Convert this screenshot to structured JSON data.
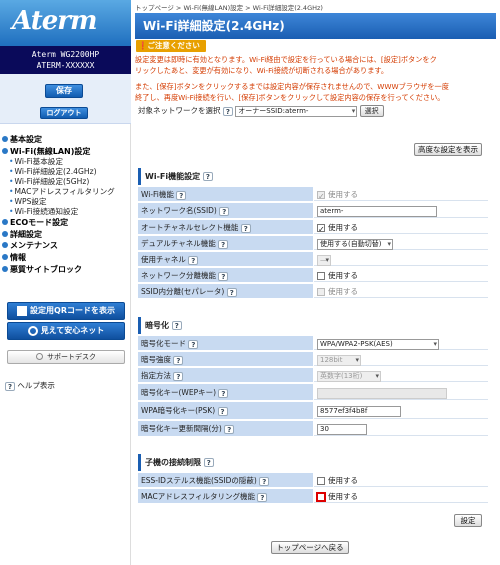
{
  "logo": "Aterm",
  "model": {
    "line1": "Aterm WG2200HP",
    "line2": "ATERM-XXXXXX"
  },
  "side_buttons": {
    "save": "保存",
    "logout": "ログアウト"
  },
  "nav": [
    {
      "label": "基本設定",
      "level": 1
    },
    {
      "label": "Wi-Fi(無線LAN)設定",
      "level": 1
    },
    {
      "label": "Wi-Fi基本設定",
      "level": 2
    },
    {
      "label": "Wi-Fi詳細設定(2.4GHz)",
      "level": 2
    },
    {
      "label": "Wi-Fi詳細設定(5GHz)",
      "level": 2
    },
    {
      "label": "MACアドレスフィルタリング",
      "level": 2
    },
    {
      "label": "WPS設定",
      "level": 2
    },
    {
      "label": "Wi-Fi接続通知設定",
      "level": 2
    },
    {
      "label": "ECOモード設定",
      "level": 1
    },
    {
      "label": "詳細設定",
      "level": 1
    },
    {
      "label": "メンテナンス",
      "level": 1
    },
    {
      "label": "情報",
      "level": 1
    },
    {
      "label": "悪質サイトブロック",
      "level": 1
    }
  ],
  "side_boxes": {
    "qr": "設定用QRコードを表示",
    "anshin": "見えて安心ネット",
    "support": "サポートデスク",
    "help": "ヘルプ表示"
  },
  "breadcrumb": "トップページ > Wi-Fi(無線LAN)設定 > Wi-Fi詳細設定(2.4GHz)",
  "page_title": "Wi-Fi詳細設定(2.4GHz)",
  "caution_label": "ご注意ください",
  "warn1a": "設定変更は即時に有効となります。Wi-Fi経由で設定を行っている場合には、[設定]ボタンをク",
  "warn1b": "リックしたあと、変更が有効になり、Wi-Fi接続が切断される場合があります。",
  "warn2a": "また、[保存]ボタンをクリックするまでは設定内容が保存されませんので、WWWブラウザを一度",
  "warn2b": "終了し、再度Wi-Fi接続を行い、[保存]ボタンをクリックして設定内容の保存を行ってください。",
  "target": {
    "label": "対象ネットワークを選択",
    "value": "オーナーSSID:aterm-",
    "select_btn": "選択"
  },
  "advanced_btn": "高度な設定を表示",
  "sec1": {
    "title": "Wi-Fi機能設定",
    "rows": [
      {
        "label": "Wi-Fi機能",
        "value": "使用する"
      },
      {
        "label": "ネットワーク名(SSID)",
        "value": "aterm-"
      },
      {
        "label": "オートチャネルセレクト機能",
        "value": "使用する"
      },
      {
        "label": "デュアルチャネル機能",
        "value": "使用する(自動切替)"
      },
      {
        "label": "使用チャネル",
        "value": "—"
      },
      {
        "label": "ネットワーク分離機能",
        "value": "使用する"
      },
      {
        "label": "SSID内分離(セパレータ)",
        "value": "使用する"
      }
    ]
  },
  "sec2": {
    "title": "暗号化",
    "rows": [
      {
        "label": "暗号化モード",
        "value": "WPA/WPA2-PSK(AES)"
      },
      {
        "label": "暗号強度",
        "value": "128bit"
      },
      {
        "label": "指定方法",
        "value": "英数字(13桁)"
      },
      {
        "label": "暗号化キー(WEPキー)",
        "value": ""
      },
      {
        "label": "WPA暗号化キー(PSK)",
        "value": "8577ef3f4b8f"
      },
      {
        "label": "暗号化キー更新間隔(分)",
        "value": "30"
      }
    ]
  },
  "sec3": {
    "title": "子機の接続制限",
    "rows": [
      {
        "label": "ESS-IDステルス機能(SSIDの隠蔽)",
        "value": "使用する"
      },
      {
        "label": "MACアドレスフィルタリング機能",
        "value": "使用する"
      }
    ]
  },
  "set_btn": "設定",
  "top_btn": "トップページへ戻る"
}
